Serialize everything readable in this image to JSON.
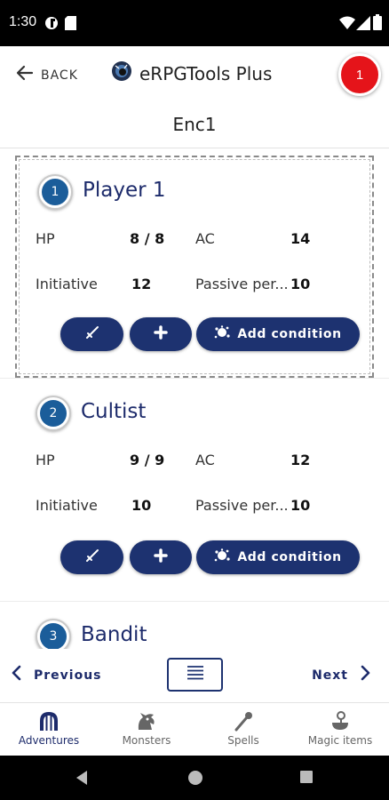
{
  "status_bar": {
    "time": "1:30",
    "icons": [
      "app-notification-icon",
      "sim-card-icon",
      "wifi-icon",
      "signal-icon",
      "battery-icon"
    ]
  },
  "app_bar": {
    "back_label": "BACK",
    "app_title": "eRPGTools Plus",
    "notification_count": "1",
    "accent_color": "#e5141a"
  },
  "encounter": {
    "title": "Enc1"
  },
  "combatants": [
    {
      "number": "1",
      "name": "Player 1",
      "hp_label": "HP",
      "hp_value": "8 / 8",
      "ac_label": "AC",
      "ac_value": "14",
      "init_label": "Initiative",
      "init_value": "12",
      "pp_label": "Passive per...",
      "pp_value": "10",
      "condition_label": "Add condition",
      "active": true
    },
    {
      "number": "2",
      "name": "Cultist",
      "hp_label": "HP",
      "hp_value": "9 / 9",
      "ac_label": "AC",
      "ac_value": "12",
      "init_label": "Initiative",
      "init_value": "10",
      "pp_label": "Passive per...",
      "pp_value": "10",
      "condition_label": "Add condition",
      "active": false
    },
    {
      "number": "3",
      "name": "Bandit",
      "active": false
    }
  ],
  "pager": {
    "previous_label": "Previous",
    "next_label": "Next"
  },
  "bottom_nav": {
    "items": [
      {
        "label": "Adventures",
        "icon": "adventures-icon",
        "selected": true
      },
      {
        "label": "Monsters",
        "icon": "monster-icon",
        "selected": false
      },
      {
        "label": "Spells",
        "icon": "spell-wand-icon",
        "selected": false
      },
      {
        "label": "Magic items",
        "icon": "magic-items-icon",
        "selected": false
      }
    ]
  },
  "colors": {
    "primary": "#1d3270",
    "title": "#1d2b6b",
    "badge_circle": "#1b5d9a"
  }
}
